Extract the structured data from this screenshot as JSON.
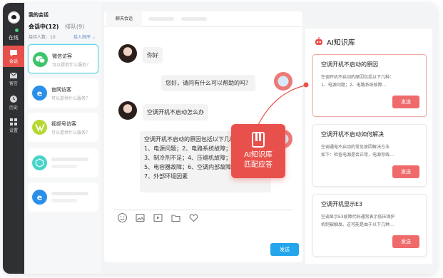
{
  "rail": {
    "status": "在线",
    "items": [
      {
        "label": "会话",
        "icon": "chat-icon"
      },
      {
        "label": "留言",
        "icon": "mail-icon"
      },
      {
        "label": "历史",
        "icon": "clock-icon"
      },
      {
        "label": "设置",
        "icon": "grid-icon"
      }
    ]
  },
  "list": {
    "title": "我的会话",
    "tab_active": "会话中(12)",
    "tab_inactive": "排队(9)",
    "subtitle": "接待人数：10",
    "sort_label": "接入顺序 ⌄",
    "visitors": [
      {
        "name": "微信访客",
        "desc": "可以提供什么服务？",
        "icon": "wechat-icon",
        "color": "#3cc46a"
      },
      {
        "name": "官网访客",
        "desc": "可以提供什么服务？",
        "icon": "browser-icon",
        "color": "#2a8fe8"
      },
      {
        "name": "视频号访客",
        "desc": "可以提供什么服务？",
        "icon": "video-channel-icon",
        "color": "#b6d832"
      }
    ],
    "placeholders": [
      {
        "icon": "cube-icon",
        "color": "#49d4c9"
      },
      {
        "icon": "browser-icon",
        "color": "#2a8fe8"
      }
    ]
  },
  "chat": {
    "tab": "聊天会话",
    "messages": [
      {
        "from": "user",
        "text": "你好"
      },
      {
        "from": "agent",
        "text": "您好，请问有什么可以帮助的吗？"
      },
      {
        "from": "user",
        "text": "空调开机不启动怎么办"
      },
      {
        "from": "agent",
        "lines": [
          "空调开机不启动的原因包括以下几种：",
          "1、电源问题；2、电路系统故障；",
          "3、制冷剂不足；4、压缩机故障；",
          "5、电容器故障；6、空调内部故障；",
          "7、外部环境因素"
        ]
      }
    ],
    "send_label": "发送"
  },
  "overlay": {
    "line1": "AI知识库",
    "line2": "匹配应答"
  },
  "kb": {
    "title": "AI知识库",
    "accent": "#e8514b",
    "cards": [
      {
        "q": "空调开机不启动的原因",
        "a": "空调开机不启动的原因包括以下几种：\n1、电源问题；2、电路系统故障…",
        "btn": "发送"
      },
      {
        "q": "空调开机不启动如何解决",
        "a": "空调通电不启动的常见原因解决方法\n如下：检查电源是否正常，电源导线…",
        "btn": "发送"
      },
      {
        "q": "空调开机显示E3",
        "a": "空调显示E3故障代码通常表示低压保护\n机制被触发。这可能是由于以下几种…",
        "btn": "发送"
      }
    ]
  }
}
